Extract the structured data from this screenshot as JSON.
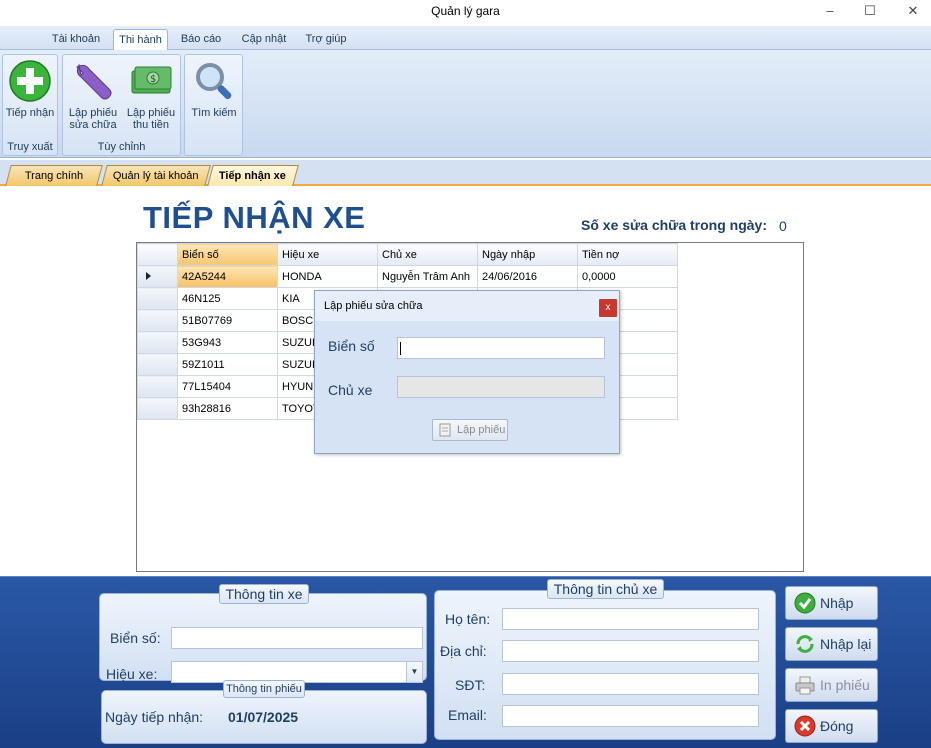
{
  "window": {
    "title": "Quản lý gara"
  },
  "menu": {
    "tabs": [
      "Tài khoản",
      "Thi hành",
      "Báo cáo",
      "Cập nhật",
      "Trợ giúp"
    ]
  },
  "ribbon": {
    "group1": {
      "label": "Truy xuất",
      "btn_receive": "Tiếp nhận"
    },
    "group2": {
      "label": "Tùy chỉnh",
      "btn_repair": [
        "Lập phiếu",
        "sửa chữa"
      ],
      "btn_payment": [
        "Lập phiếu",
        "thu tiền"
      ]
    },
    "group3": {
      "btn_search": "Tìm kiếm"
    }
  },
  "doc_tabs": [
    "Trang chính",
    "Quản lý tài khoản",
    "Tiếp nhận xe"
  ],
  "page": {
    "title": "TIẾP NHẬN XE",
    "count_label": "Số xe sửa chữa trong ngày:",
    "count_value": "0"
  },
  "grid": {
    "headers": [
      "Biển số",
      "Hiệu xe",
      "Chủ xe",
      "Ngày nhập",
      "Tiền nợ"
    ],
    "rows": [
      [
        "42A5244",
        "HONDA",
        "Nguyễn Trâm Anh",
        "24/06/2016",
        "0,0000"
      ],
      [
        "46N125",
        "KIA",
        "",
        "",
        ""
      ],
      [
        "51B07769",
        "BOSCH",
        "",
        "",
        ""
      ],
      [
        "53G943",
        "SUZUKI",
        "",
        "",
        ""
      ],
      [
        "59Z1011",
        "SUZUKI",
        "",
        "",
        ""
      ],
      [
        "77L15404",
        "HYUNDAI",
        "",
        "",
        ""
      ],
      [
        "93h28816",
        "TOYOTA",
        "",
        "",
        ""
      ]
    ]
  },
  "dialog": {
    "title": "Lập phiếu sửa chữa",
    "close": "x",
    "plate_label": "Biển số",
    "owner_label": "Chủ xe",
    "submit": "Lập phiếu"
  },
  "vehicle_info": {
    "caption": "Thông tin xe",
    "plate_label": "Biển số:",
    "brand_label": "Hiệu xe:"
  },
  "receipt_info": {
    "caption": "Thông tin phiếu",
    "date_label": "Ngày tiếp nhận:",
    "date_value": "01/07/2025"
  },
  "owner_info": {
    "caption": "Thông tin chủ xe",
    "name_label": "Họ tên:",
    "address_label": "Địa chỉ:",
    "phone_label": "SĐT:",
    "email_label": "Email:"
  },
  "actions": {
    "submit": "Nhập",
    "reset": "Nhập lại",
    "print": "In phiếu",
    "close": "Đóng"
  }
}
